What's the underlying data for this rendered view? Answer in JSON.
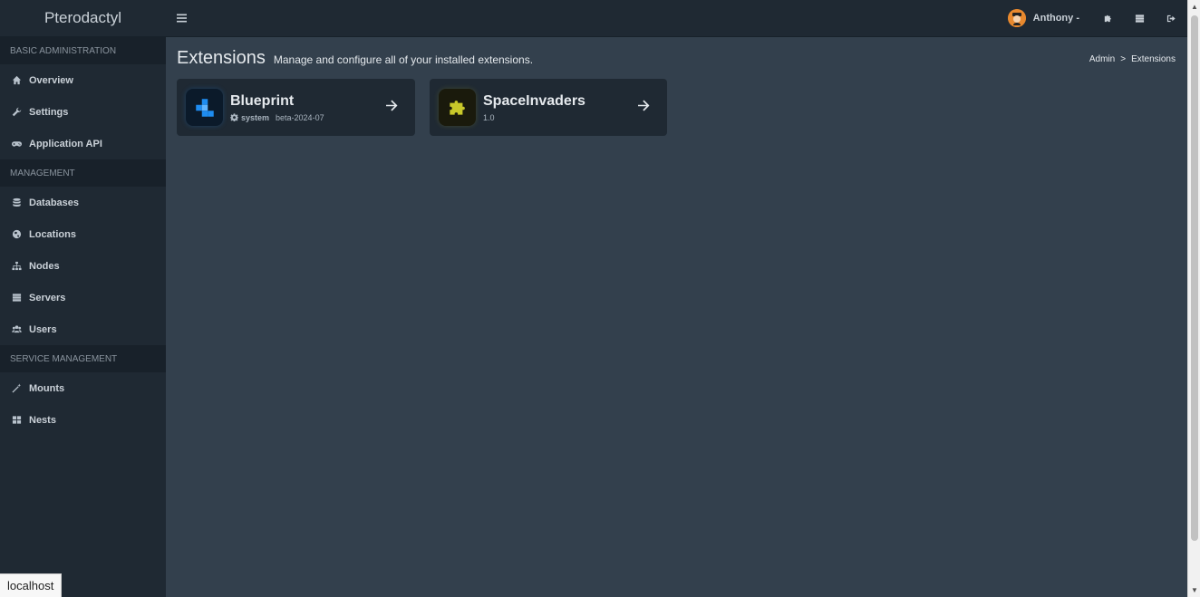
{
  "app": {
    "title": "Pterodactyl"
  },
  "sidebar": {
    "sections": [
      {
        "header": "Basic Administration",
        "items": [
          {
            "label": "Overview",
            "icon": "home-icon"
          },
          {
            "label": "Settings",
            "icon": "wrench-icon"
          },
          {
            "label": "Application API",
            "icon": "gamepad-icon"
          }
        ]
      },
      {
        "header": "Management",
        "items": [
          {
            "label": "Databases",
            "icon": "database-icon"
          },
          {
            "label": "Locations",
            "icon": "globe-icon"
          },
          {
            "label": "Nodes",
            "icon": "sitemap-icon"
          },
          {
            "label": "Servers",
            "icon": "server-icon"
          },
          {
            "label": "Users",
            "icon": "users-icon"
          }
        ]
      },
      {
        "header": "Service Management",
        "items": [
          {
            "label": "Mounts",
            "icon": "magic-wand-icon"
          },
          {
            "label": "Nests",
            "icon": "th-large-icon"
          }
        ]
      }
    ]
  },
  "topbar": {
    "username": "Anthony -",
    "icons": [
      "puzzle-icon",
      "server-icon",
      "sign-out-icon"
    ]
  },
  "page": {
    "title": "Extensions",
    "subtitle": "Manage and configure all of your installed extensions.",
    "breadcrumb": {
      "root": "Admin",
      "separator": ">",
      "current": "Extensions"
    }
  },
  "extensions": [
    {
      "name": "Blueprint",
      "author": "system",
      "version": "beta-2024-07",
      "accent": "#1e8cf0"
    },
    {
      "name": "SpaceInvaders",
      "author": "",
      "version": "1.0",
      "accent": "#c8c82a"
    }
  ],
  "status_bar": {
    "url": "localhost"
  },
  "colors": {
    "sidebar": "#1f2933",
    "content": "#33404d",
    "section_header": "#18212a"
  }
}
